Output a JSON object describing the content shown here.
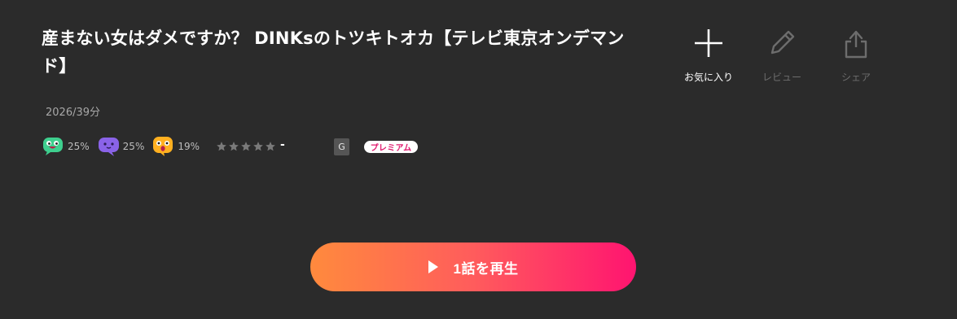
{
  "program": {
    "title": "産まない女はダメですか？ DINKsのトツキトオカ【テレビ東京オンデマンド】",
    "meta": "2026/39分"
  },
  "reactions": [
    {
      "icon": "green-laughing-face-icon",
      "percent": "25%",
      "color": "#3ecf8e"
    },
    {
      "icon": "purple-face-icon",
      "percent": "25%",
      "color": "#8a63e8"
    },
    {
      "icon": "orange-surprised-face-icon",
      "percent": "19%",
      "color": "#ffb020"
    }
  ],
  "rating": {
    "stars_filled": 0,
    "stars_total": 5,
    "value": "-"
  },
  "badges": {
    "age_rating": "G",
    "premium": "プレミアム"
  },
  "actions": [
    {
      "label": "お気に入り",
      "icon": "plus-icon",
      "enabled": true
    },
    {
      "label": "レビュー",
      "icon": "pencil-icon",
      "enabled": false
    },
    {
      "label": "シェア",
      "icon": "share-icon",
      "enabled": false
    }
  ],
  "play_button": {
    "label": "1話を再生"
  },
  "colors": {
    "background": "#2b2b2b",
    "play_gradient_start": "#ff8a3d",
    "play_gradient_end": "#ff1470",
    "premium_text": "#e0186d"
  }
}
